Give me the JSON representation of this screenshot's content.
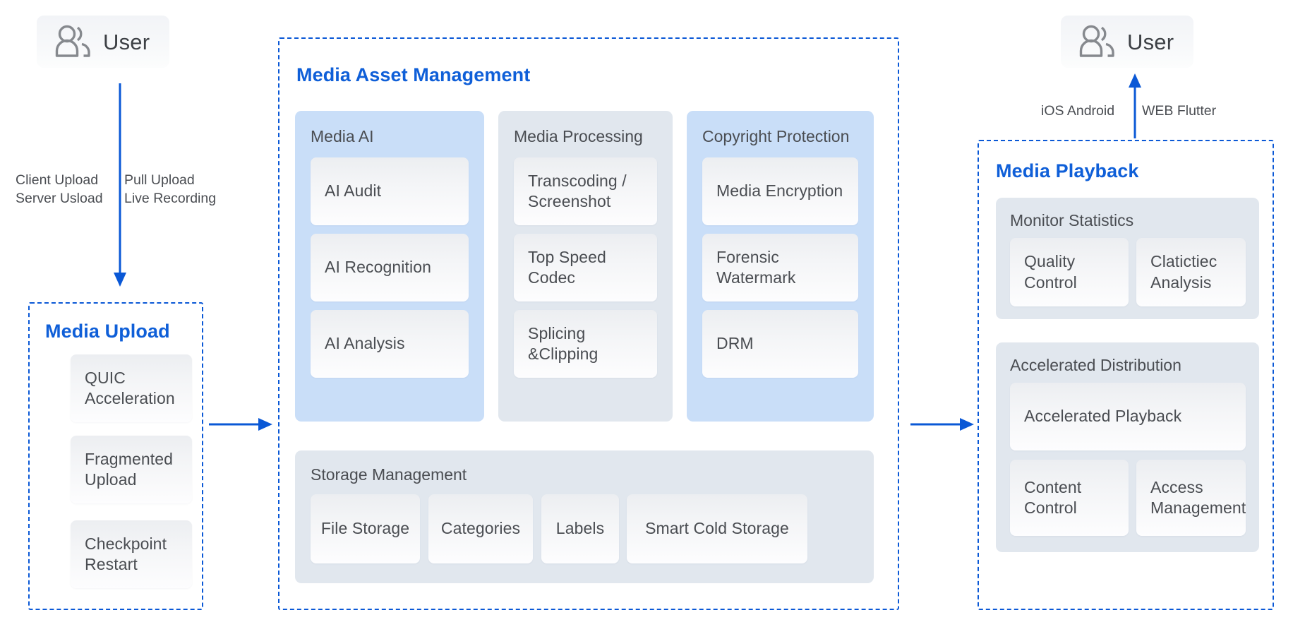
{
  "left": {
    "user": {
      "label": "User",
      "icon": "users-icon"
    },
    "flow_labels": {
      "left_col": "Client Upload\nServer Usload",
      "right_col": "Pull Upload\nLive Recording"
    },
    "section": {
      "title": "Media Upload",
      "cards": [
        "QUIC\nAcceleration",
        "Fragmented\nUpload",
        "Checkpoint\nRestart"
      ]
    }
  },
  "middle": {
    "section": {
      "title": "Media Asset Management"
    },
    "groups": [
      {
        "title": "Media AI",
        "tone": "blue",
        "cards": [
          "AI Audit",
          "AI Recognition",
          "AI Analysis"
        ]
      },
      {
        "title": "Media Processing",
        "tone": "gray",
        "cards": [
          "Transcoding /\nScreenshot",
          "Top Speed Codec",
          "Splicing &Clipping"
        ]
      },
      {
        "title": "Copyright Protection",
        "tone": "blue",
        "cards": [
          "Media Encryption",
          "Forensic\nWatermark",
          "DRM"
        ]
      }
    ],
    "storage": {
      "title": "Storage Management",
      "tone": "gray",
      "cards": [
        "File Storage",
        "Categories",
        "Labels",
        "Smart Cold Storage"
      ]
    }
  },
  "right": {
    "user": {
      "label": "User",
      "icon": "users-icon"
    },
    "platform_labels": {
      "left": "iOS Android",
      "right": "WEB Flutter"
    },
    "section": {
      "title": "Media Playback"
    },
    "groups": [
      {
        "title": "Monitor Statistics",
        "tone": "gray",
        "cards": [
          "Quality\nControl",
          "Clatictiec\nAnalysis"
        ]
      },
      {
        "title": "Accelerated Distribution",
        "tone": "gray",
        "cards": [
          "Accelerated Playback",
          "Content\nControl",
          "Access\nManagement"
        ]
      }
    ]
  },
  "colors": {
    "accent_blue": "#0a58d6",
    "title_blue": "#0f5fd8",
    "panel_blue": "#c9def8",
    "panel_gray": "#e1e7ee",
    "text_gray": "#4a4d52"
  }
}
